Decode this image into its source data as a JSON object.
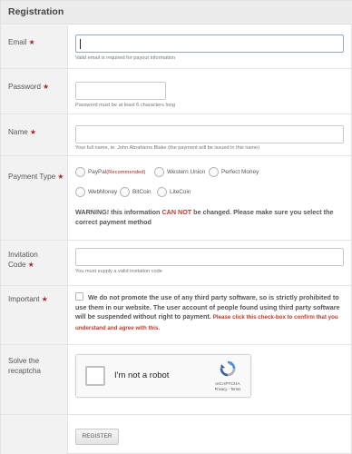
{
  "panel": {
    "title": "Registration"
  },
  "fields": {
    "email": {
      "label": "Email",
      "required_marker": "★",
      "value": "",
      "hint": "Valid email is required for payout information"
    },
    "password": {
      "label": "Password",
      "required_marker": "★",
      "value": "",
      "hint": "Password must be at least 6 characters long"
    },
    "name": {
      "label": "Name",
      "required_marker": "★",
      "value": "",
      "hint": "Your full name, ie: John Abrahams Blake (the payment will be issued in this name)"
    },
    "payment_type": {
      "label": "Payment Type",
      "required_marker": "★",
      "options": [
        {
          "label": "PayPal",
          "badge": "(Recommended)"
        },
        {
          "label": "Western Union",
          "badge": ""
        },
        {
          "label": "Perfect Money",
          "badge": ""
        },
        {
          "label": "WebMoney",
          "badge": ""
        },
        {
          "label": "BitCoin",
          "badge": ""
        },
        {
          "label": "LiteCoin",
          "badge": ""
        }
      ],
      "warning_prefix": "WARNING! this information ",
      "warning_emphasis": "CAN NOT",
      "warning_suffix": " be changed. Please make sure you select the correct payment method"
    },
    "invitation_code": {
      "label": "Invitation Code",
      "required_marker": "★",
      "value": "",
      "hint": "You must supply a valid invitation code"
    },
    "important": {
      "label": "Important",
      "required_marker": "★",
      "text": "We do not promote the use of any third party software, so is strictly prohibited to use them in our website. The user account of people found using third party software will be suspended without right to payment.",
      "note": "Please click this check-box to confirm that you understand and agree with this."
    },
    "captcha": {
      "label": "Solve the recaptcha",
      "checkbox_text": "I'm not a robot",
      "brand": "reCAPTCHA",
      "links": "Privacy - Terms"
    }
  },
  "actions": {
    "register_label": "REGISTER"
  },
  "colors": {
    "required_star": "#a52a2a",
    "warning_red": "#c0392b",
    "label_bg": "#f2f2f2",
    "header_bg": "#ececec"
  }
}
